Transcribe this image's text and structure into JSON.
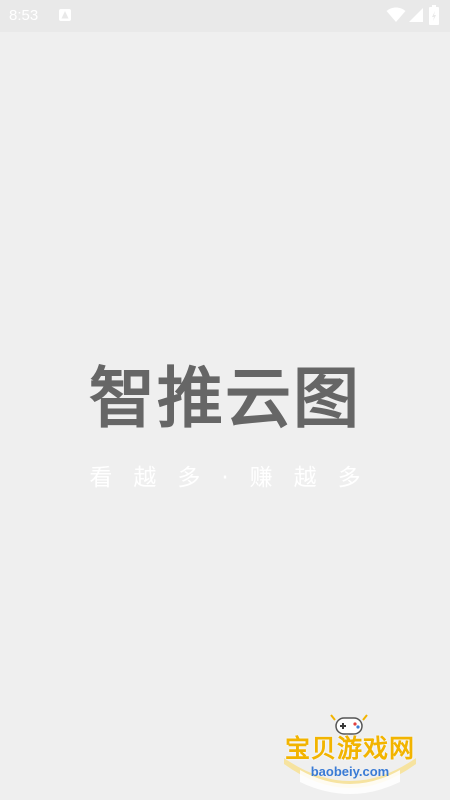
{
  "status_bar": {
    "time": "8:53",
    "icons": [
      "notification-icon",
      "wifi-icon",
      "signal-icon",
      "battery-icon"
    ]
  },
  "splash": {
    "title": "智推云图",
    "slogan": "看越多·赚越多"
  },
  "watermark": {
    "name": "宝贝游戏网",
    "url": "baobeiy.com"
  },
  "colors": {
    "background": "#efefef",
    "title": "#666666",
    "slogan": "#ffffff",
    "watermark_name": "#f2b400",
    "watermark_url": "#3a7bd5"
  }
}
